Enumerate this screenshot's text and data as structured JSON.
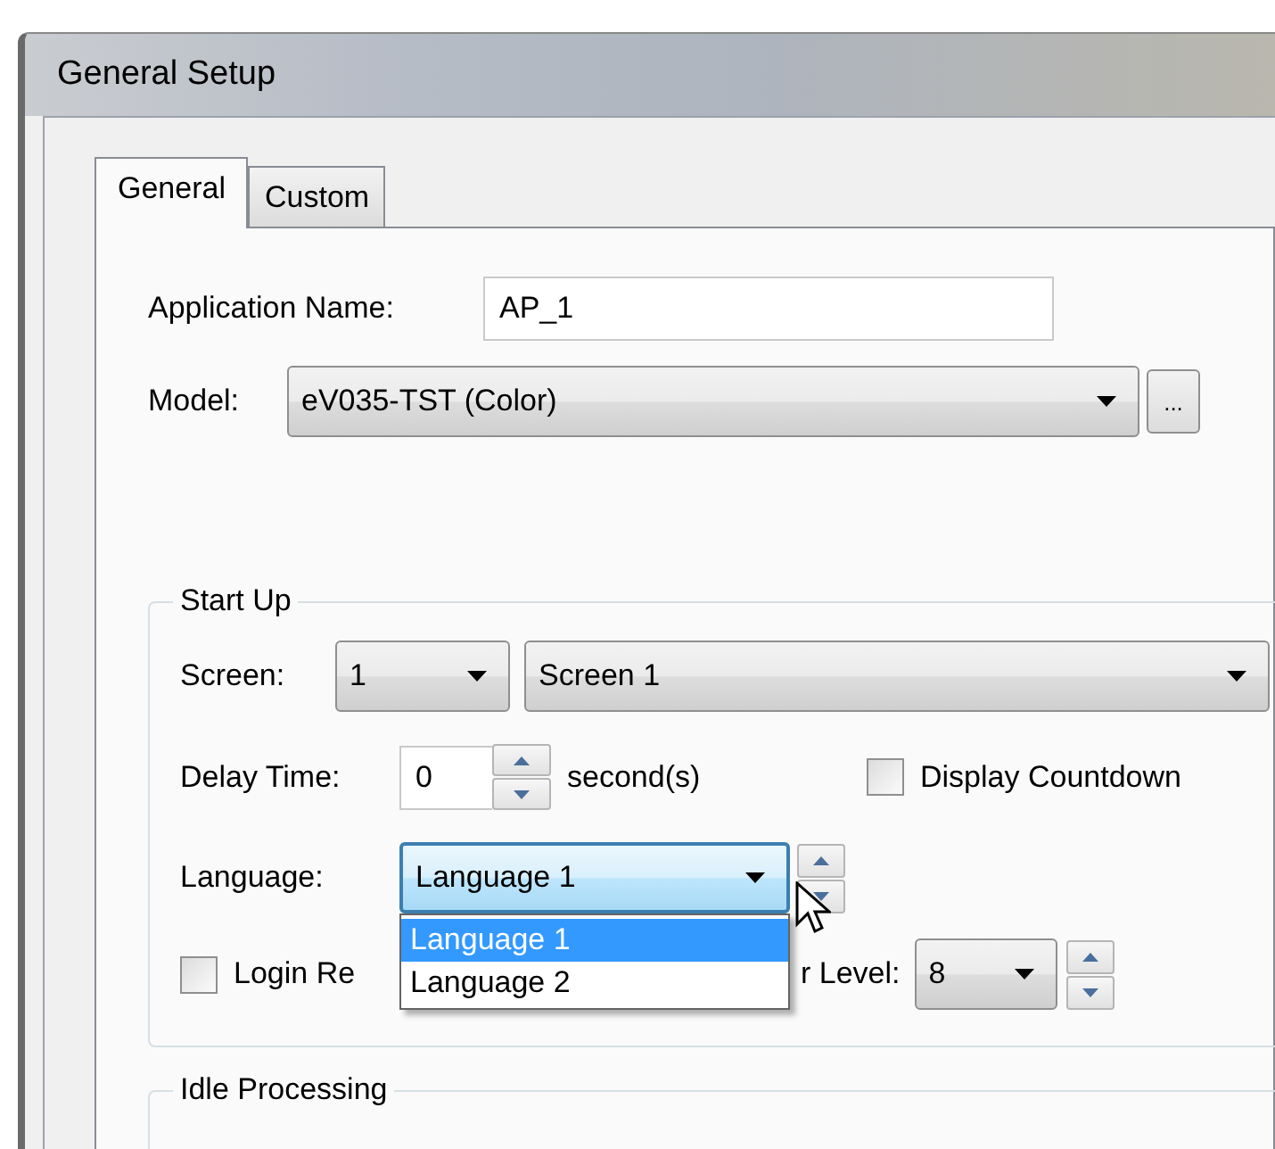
{
  "window": {
    "title": "General Setup"
  },
  "tabs": [
    {
      "label": "General",
      "selected": true
    },
    {
      "label": "Custom",
      "selected": false
    }
  ],
  "application_name": {
    "label": "Application Name:",
    "value": "AP_1"
  },
  "model": {
    "label": "Model:",
    "value": "eV035-TST (Color)",
    "browse_button": "..."
  },
  "start_up": {
    "title": "Start Up",
    "screen": {
      "label": "Screen:",
      "number": "1",
      "name": "Screen 1"
    },
    "delay_time": {
      "label": "Delay Time:",
      "value": "0",
      "unit": "second(s)"
    },
    "display_countdown": {
      "label": "Display Countdown",
      "checked": false
    },
    "language": {
      "label": "Language:",
      "value": "Language 1",
      "expanded": true,
      "options": [
        {
          "label": "Language 1",
          "selected": true
        },
        {
          "label": "Language 2",
          "selected": false
        }
      ]
    },
    "login_required": {
      "label": "Login Re",
      "checked": false
    },
    "user_level": {
      "label": "r Level:",
      "value": "8"
    }
  },
  "idle_processing": {
    "title": "Idle Processing"
  }
}
